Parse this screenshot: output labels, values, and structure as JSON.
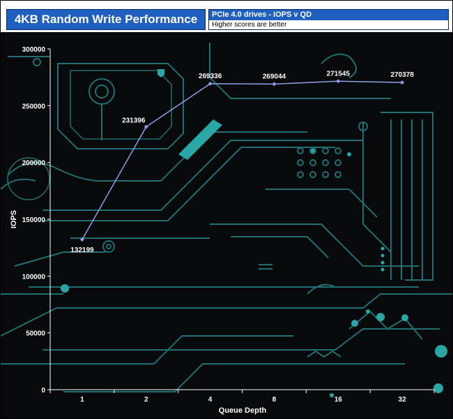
{
  "header": {
    "title": "4KB Random Write Performance",
    "subtitle": "PCIe 4.0 drives - IOPS v QD",
    "note": "Higher scores are better"
  },
  "colors": {
    "background": "#07090b",
    "circuit": "#1f6f73",
    "circuit_bright": "#2aa6a6",
    "line": "#8f9ee8",
    "header_blue": "#1f5fbf"
  },
  "chart_data": {
    "type": "line",
    "title": "4KB Random Write Performance",
    "xlabel": "Queue Depth",
    "ylabel": "IOPS",
    "categories": [
      "1",
      "2",
      "4",
      "8",
      "16",
      "32"
    ],
    "series": [
      {
        "values": [
          132199,
          231396,
          269336,
          269044,
          271545,
          270378
        ]
      }
    ],
    "ylim": [
      0,
      300000
    ],
    "yticks": [
      0,
      50000,
      100000,
      150000,
      200000,
      250000,
      300000
    ],
    "data_labels": [
      "132199",
      "231396",
      "269336",
      "269044",
      "271545",
      "270378"
    ],
    "grid": false,
    "legend": "none"
  }
}
